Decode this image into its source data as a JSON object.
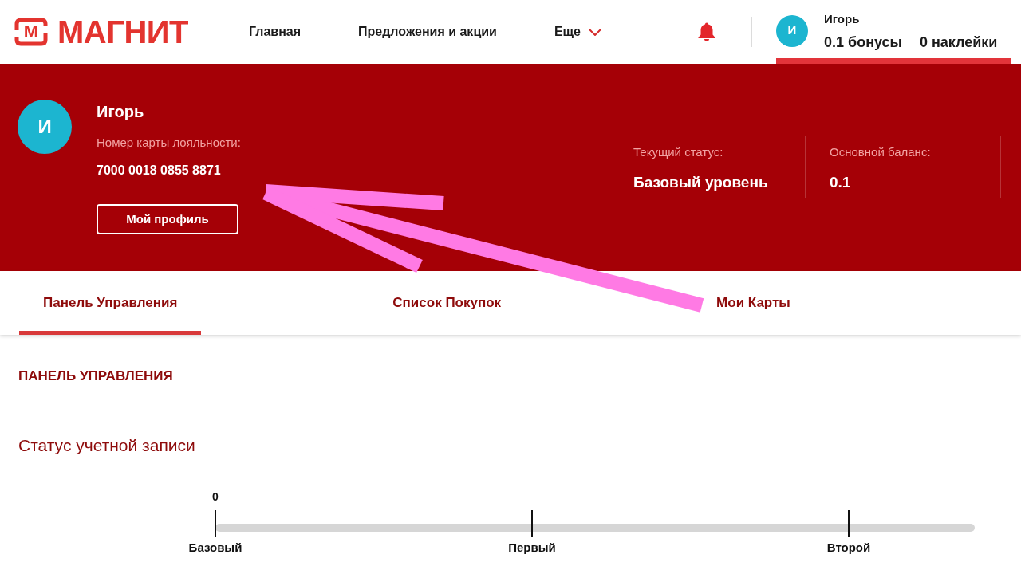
{
  "header": {
    "logo": {
      "mark": "М",
      "name": "МАГНИТ"
    },
    "nav": [
      {
        "label": "Главная",
        "kind": "link",
        "selected": false
      },
      {
        "label": "Предложения и акции",
        "kind": "link",
        "selected": false
      },
      {
        "label": "Еще",
        "kind": "dropdown",
        "selected": false
      }
    ],
    "account": {
      "avatar": "И",
      "name": "Игорь",
      "bonuses": "0.1 бонусы",
      "stickers": "0 наклейки",
      "selected": true
    }
  },
  "profile": {
    "avatar": "И",
    "name": "Игорь",
    "card_label": "Номер карты лояльности:",
    "card_number": "7000 0018 0855 8871",
    "button": "Мой профиль",
    "stats": [
      {
        "label": "Текущий статус:",
        "value": "Базовый уровень"
      },
      {
        "label": "Основной баланс:",
        "value": "0.1"
      }
    ]
  },
  "tabs": [
    {
      "label": "Панель Управления",
      "selected": true
    },
    {
      "label": "Список Покупок",
      "selected": false
    },
    {
      "label": "Мои Карты",
      "selected": false
    }
  ],
  "dashboard": {
    "title": "ПАНЕЛЬ УПРАВЛЕНИЯ",
    "section": "Статус учетной записи",
    "status_scale": {
      "reading": "0",
      "milestones": [
        "Базовый",
        "Первый",
        "Второй"
      ]
    }
  }
}
